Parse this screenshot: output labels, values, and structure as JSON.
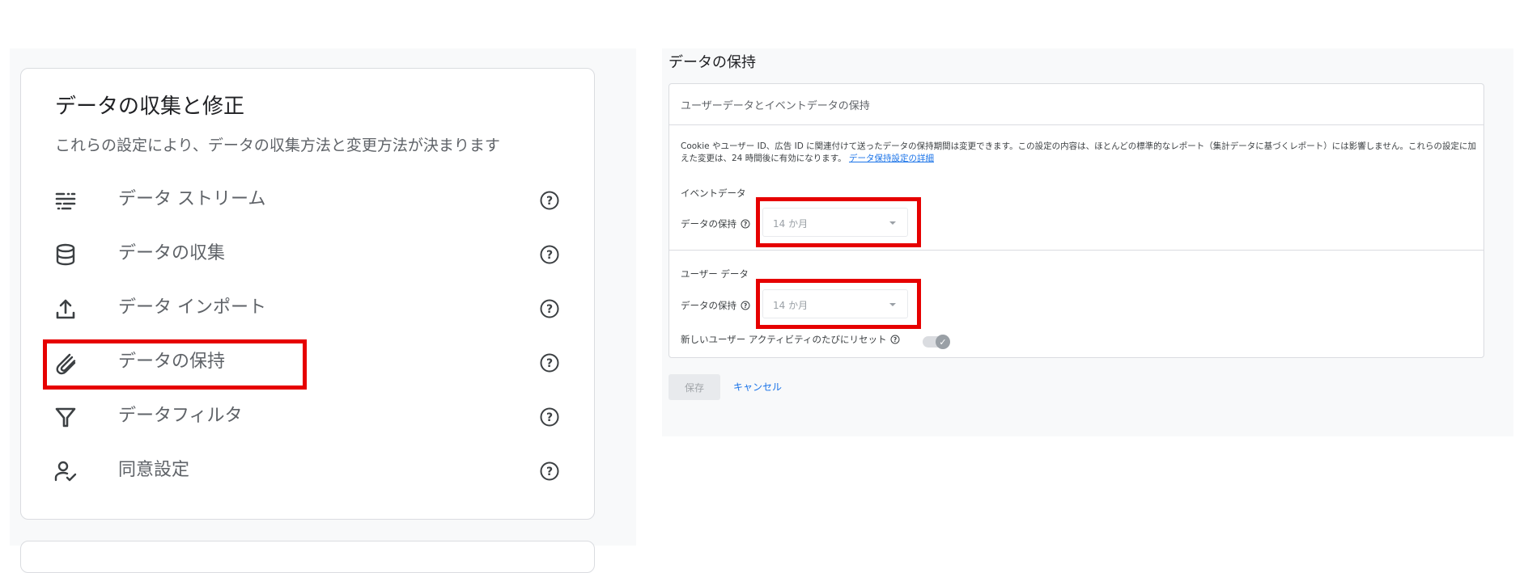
{
  "left": {
    "title": "データの収集と修正",
    "subtitle": "これらの設定により、データの収集方法と変更方法が決まります",
    "items": [
      {
        "label": "データ ストリーム",
        "icon": "data-streams-icon"
      },
      {
        "label": "データの収集",
        "icon": "database-icon"
      },
      {
        "label": "データ インポート",
        "icon": "upload-icon"
      },
      {
        "label": "データの保持",
        "icon": "retention-icon"
      },
      {
        "label": "データフィルタ",
        "icon": "filter-icon"
      },
      {
        "label": "同意設定",
        "icon": "consent-icon"
      }
    ]
  },
  "right": {
    "title": "データの保持",
    "card_header": "ユーザーデータとイベントデータの保持",
    "description": "Cookie やユーザー ID、広告 ID に関連付けて送ったデータの保持期間は変更できます。この設定の内容は、ほとんどの標準的なレポート（集計データに基づくレポート）には影響しません。これらの設定に加えた変更は、24 時間後に有効になります。",
    "description_link": "データ保持設定の詳細",
    "event_section_label": "イベントデータ",
    "event_retention_label": "データの保持",
    "event_retention_value": "14 か月",
    "user_section_label": "ユーザー データ",
    "user_retention_label": "データの保持",
    "user_retention_value": "14 か月",
    "reset_label": "新しいユーザー アクティビティのたびにリセット",
    "reset_enabled": true,
    "save_label": "保存",
    "cancel_label": "キャンセル"
  },
  "colors": {
    "highlight": "#e60000",
    "link": "#1a73e8",
    "panel_bg": "#f8f9fa",
    "border": "#dadce0"
  }
}
